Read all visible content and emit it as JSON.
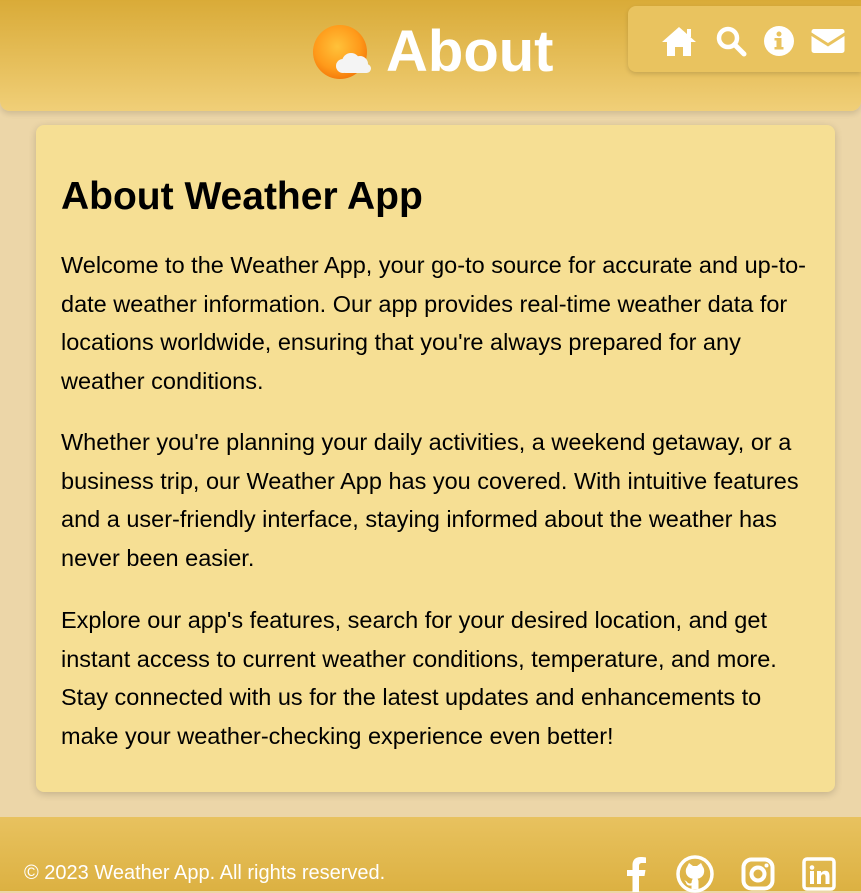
{
  "header": {
    "title": "About",
    "logo_icon": "sun-cloud-icon",
    "nav": [
      {
        "name": "home",
        "icon": "home-icon"
      },
      {
        "name": "search",
        "icon": "search-icon"
      },
      {
        "name": "about",
        "icon": "info-icon"
      },
      {
        "name": "contact",
        "icon": "envelope-icon"
      }
    ]
  },
  "content": {
    "heading": "About Weather App",
    "paragraphs": [
      "Welcome to the Weather App, your go-to source for accurate and up-to-date weather information. Our app provides real-time weather data for locations worldwide, ensuring that you're always prepared for any weather conditions.",
      "Whether you're planning your daily activities, a weekend getaway, or a business trip, our Weather App has you covered. With intuitive features and a user-friendly interface, staying informed about the weather has never been easier.",
      "Explore our app's features, search for your desired location, and get instant access to current weather conditions, temperature, and more. Stay connected with us for the latest updates and enhancements to make your weather-checking experience even better!"
    ]
  },
  "footer": {
    "copyright": "© 2023 Weather App. All rights reserved.",
    "social": [
      "facebook-icon",
      "github-icon",
      "instagram-icon",
      "linkedin-icon"
    ]
  },
  "colors": {
    "header_accent": "#d9ab38",
    "card_background": "#f6df94",
    "page_background": "#ecd6a8",
    "text": "#000000",
    "header_text": "#ffffff"
  }
}
